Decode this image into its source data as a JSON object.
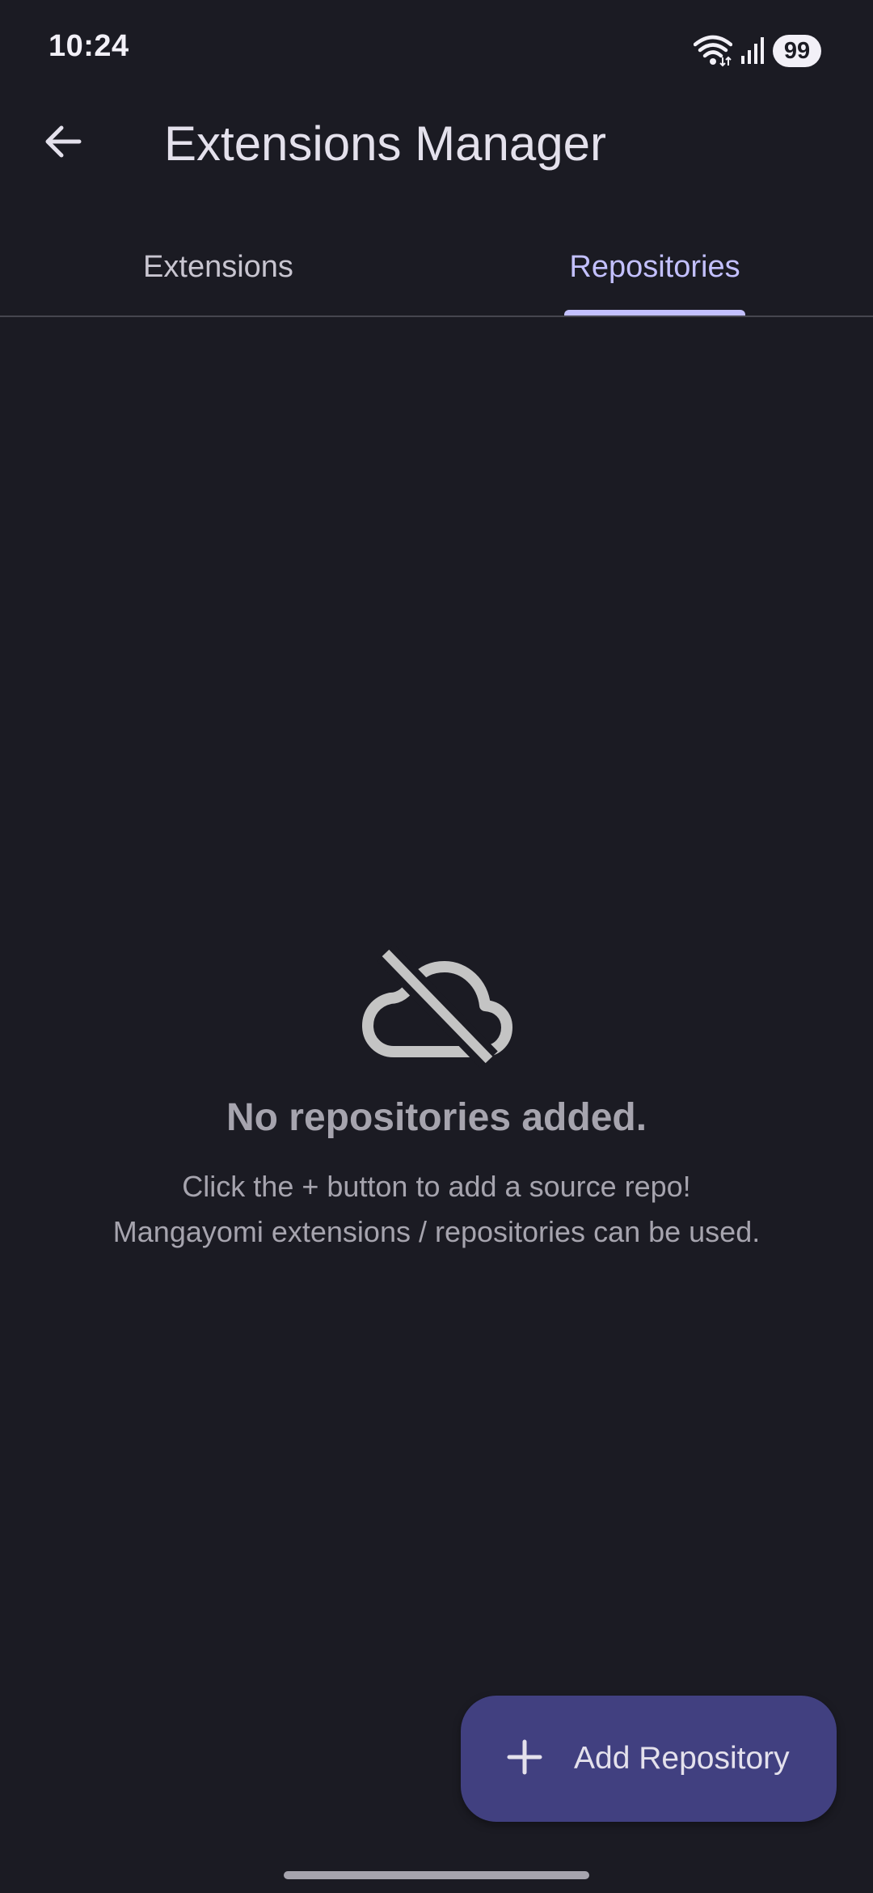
{
  "status_bar": {
    "time": "10:24",
    "battery": "99",
    "icons": [
      "wifi-icon",
      "signal-icon"
    ]
  },
  "app_bar": {
    "title": "Extensions Manager",
    "back_icon": "arrow-left-icon"
  },
  "tabs": [
    {
      "label": "Extensions",
      "active": false
    },
    {
      "label": "Repositories",
      "active": true
    }
  ],
  "empty_state": {
    "icon": "cloud-off-icon",
    "title": "No repositories added.",
    "description_line1": "Click the + button to add a source repo!",
    "description_line2": "Mangayomi extensions / repositories can be used."
  },
  "fab": {
    "icon": "plus-icon",
    "label": "Add Repository"
  },
  "colors": {
    "background": "#1b1b23",
    "accent": "#c3c0ff",
    "fab_background": "#414080",
    "muted_text": "#a6a4ae"
  }
}
